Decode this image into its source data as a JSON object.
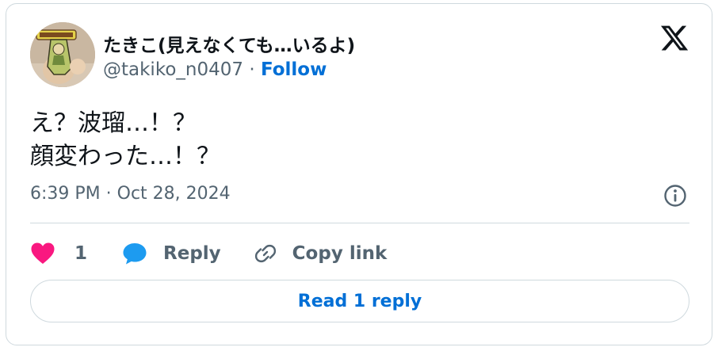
{
  "author": {
    "display_name": "たきこ(見えなくても…いるよ)",
    "handle": "@takiko_n0407",
    "separator": " · ",
    "follow_label": "Follow",
    "avatar_icon": "avatar-keychain-photo"
  },
  "brand": {
    "logo_icon": "x-logo-icon"
  },
  "tweet": {
    "lines": [
      "え？波瑠…！？",
      "顔変わった…！？"
    ],
    "timestamp": "6:39 PM · Oct 28, 2024"
  },
  "actions": {
    "like_count": "1",
    "reply_label": "Reply",
    "copy_link_label": "Copy link",
    "like_icon": "heart-icon",
    "reply_icon": "speech-bubble-icon",
    "copy_icon": "link-icon",
    "info_icon": "info-icon"
  },
  "footer": {
    "read_replies_label": "Read 1 reply"
  },
  "colors": {
    "text": "#0f1419",
    "muted": "#536471",
    "link": "#006fd6",
    "heart": "#f91880",
    "reply_bubble": "#1d9bf0",
    "border": "#cfd9de"
  }
}
